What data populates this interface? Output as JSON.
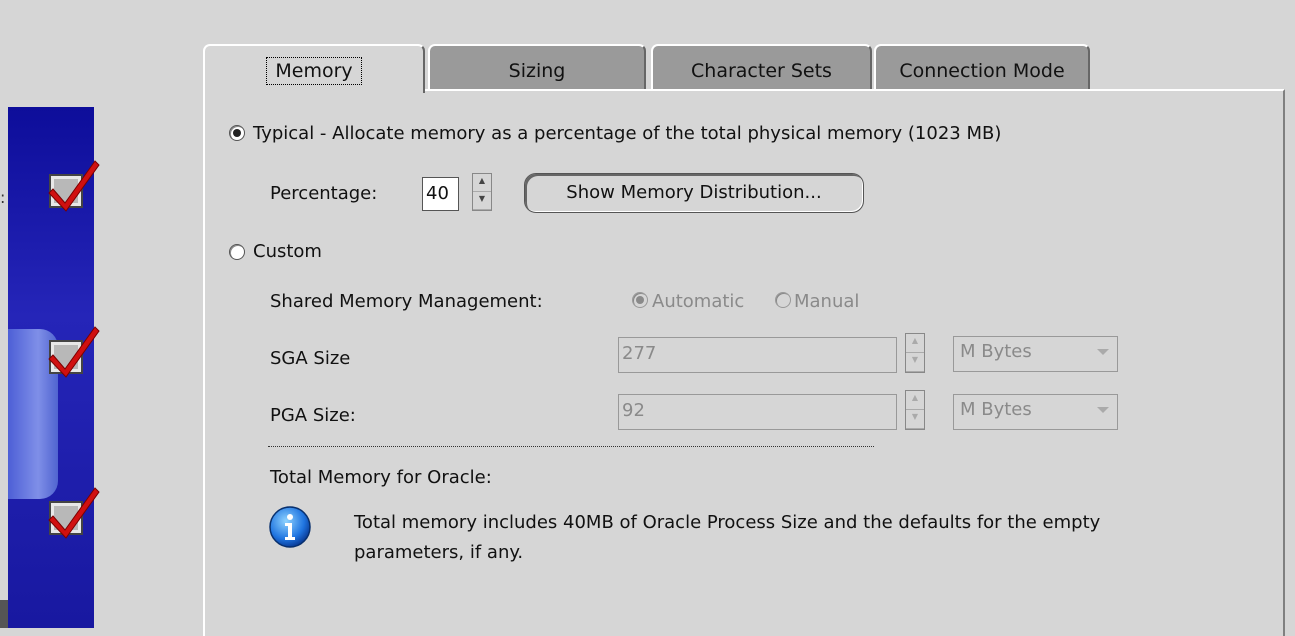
{
  "tabs": [
    {
      "label": "Memory",
      "active": true
    },
    {
      "label": "Sizing",
      "active": false
    },
    {
      "label": "Character Sets",
      "active": false
    },
    {
      "label": "Connection Mode",
      "active": false
    }
  ],
  "memory": {
    "typical_label": "Typical - Allocate memory as a percentage of the total physical memory (1023 MB)",
    "percentage_label": "Percentage:",
    "percentage_value": "40",
    "show_distribution_button": "Show Memory Distribution...",
    "custom_label": "Custom",
    "shared_mem_label": "Shared Memory Management:",
    "automatic_label": "Automatic",
    "manual_label": "Manual",
    "sga_label": "SGA Size",
    "sga_value": "277",
    "sga_unit": "M Bytes",
    "pga_label": "PGA Size:",
    "pga_value": "92",
    "pga_unit": "M Bytes",
    "total_label": "Total Memory for Oracle:",
    "info_line1": "Total memory includes 40MB of Oracle Process Size and the defaults for the empty",
    "info_line2": "parameters, if any."
  },
  "left_strip": {
    "step_checks": [
      "checked",
      "checked",
      "checked"
    ]
  },
  "colors": {
    "background": "#d6d6d6",
    "wizard_blue": "#1a1aa8",
    "check_red": "#d01010"
  }
}
